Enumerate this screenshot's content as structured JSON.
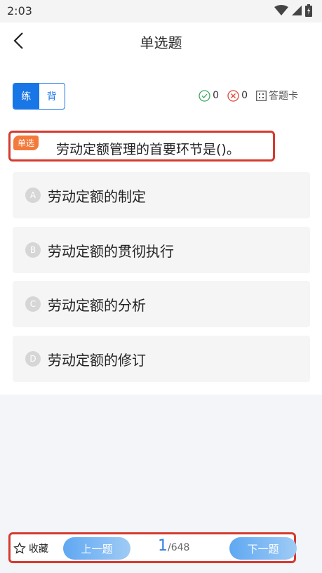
{
  "status": {
    "time": "2:03"
  },
  "header": {
    "title": "单选题"
  },
  "mode": {
    "practice": "练",
    "recite": "背"
  },
  "stats": {
    "correct": "0",
    "wrong": "0",
    "answer_card": "答题卡"
  },
  "question": {
    "tag": "单选",
    "text": "劳动定额管理的首要环节是()。",
    "options": [
      {
        "letter": "A",
        "text": "劳动定额的制定"
      },
      {
        "letter": "B",
        "text": "劳动定额的贯彻执行"
      },
      {
        "letter": "C",
        "text": "劳动定额的分析"
      },
      {
        "letter": "D",
        "text": "劳动定额的修订"
      }
    ]
  },
  "bottom": {
    "favorite": "收藏",
    "prev": "上一题",
    "next": "下一题",
    "current": "1",
    "total": "/648"
  },
  "colors": {
    "accent": "#1976e6",
    "highlight_border": "#d63a2e",
    "tag": "#f47a3a"
  }
}
